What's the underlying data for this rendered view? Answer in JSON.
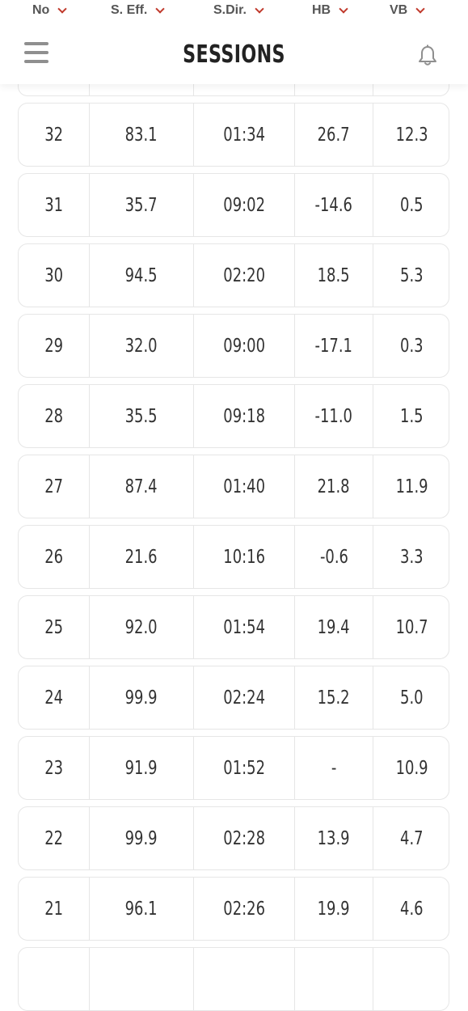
{
  "header": {
    "title": "SESSIONS",
    "columns": [
      {
        "label": "No"
      },
      {
        "label": "S. Eff."
      },
      {
        "label": "S.Dir."
      },
      {
        "label": "HB"
      },
      {
        "label": "VB"
      }
    ],
    "menu_icon": "hamburger-menu-icon",
    "bell_icon": "bell-icon"
  },
  "colors": {
    "accent": "#c0392b",
    "border": "#e6e6e6",
    "text": "#333333"
  },
  "rows": [
    {
      "no": "",
      "eff": "",
      "dir": "",
      "hb": "",
      "vb": ""
    },
    {
      "no": "32",
      "eff": "83.1",
      "dir": "01:34",
      "hb": "26.7",
      "vb": "12.3"
    },
    {
      "no": "31",
      "eff": "35.7",
      "dir": "09:02",
      "hb": "-14.6",
      "vb": "0.5"
    },
    {
      "no": "30",
      "eff": "94.5",
      "dir": "02:20",
      "hb": "18.5",
      "vb": "5.3"
    },
    {
      "no": "29",
      "eff": "32.0",
      "dir": "09:00",
      "hb": "-17.1",
      "vb": "0.3"
    },
    {
      "no": "28",
      "eff": "35.5",
      "dir": "09:18",
      "hb": "-11.0",
      "vb": "1.5"
    },
    {
      "no": "27",
      "eff": "87.4",
      "dir": "01:40",
      "hb": "21.8",
      "vb": "11.9"
    },
    {
      "no": "26",
      "eff": "21.6",
      "dir": "10:16",
      "hb": "-0.6",
      "vb": "3.3"
    },
    {
      "no": "25",
      "eff": "92.0",
      "dir": "01:54",
      "hb": "19.4",
      "vb": "10.7"
    },
    {
      "no": "24",
      "eff": "99.9",
      "dir": "02:24",
      "hb": "15.2",
      "vb": "5.0"
    },
    {
      "no": "23",
      "eff": "91.9",
      "dir": "01:52",
      "hb": "-",
      "vb": "10.9"
    },
    {
      "no": "22",
      "eff": "99.9",
      "dir": "02:28",
      "hb": "13.9",
      "vb": "4.7"
    },
    {
      "no": "21",
      "eff": "96.1",
      "dir": "02:26",
      "hb": "19.9",
      "vb": "4.6"
    },
    {
      "no": "",
      "eff": "",
      "dir": "",
      "hb": "",
      "vb": ""
    }
  ]
}
